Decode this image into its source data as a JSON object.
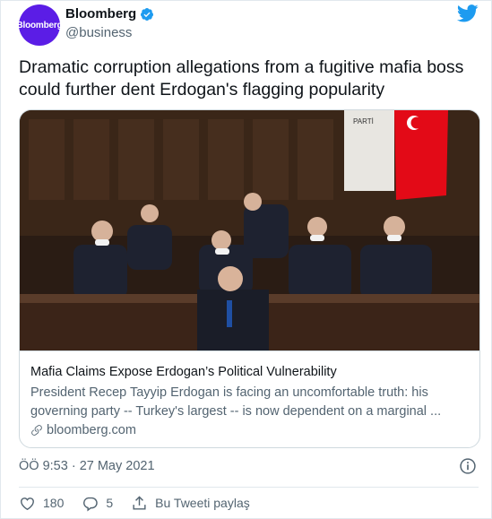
{
  "author": {
    "avatar_text": "Bloomberg",
    "name": "Bloomberg",
    "handle": "@business",
    "avatar_color": "#5b1de6",
    "verified_color": "#1d9bf0"
  },
  "tweet": {
    "text": "Dramatic corruption allegations from a fugitive mafia boss could further dent Erdogan's flagging popularity",
    "timestamp": "ÖÖ 9:53 · 27 May 2021"
  },
  "card": {
    "image_alt": "Photo of politicians seated at a parliament podium with a Turkish flag",
    "image_signage_text": "PARTİ",
    "title": "Mafia Claims Expose Erdogan’s Political Vulnerability",
    "description": "President Recep Tayyip Erdogan is facing an uncomfortable truth: his governing party -- Turkey's largest -- is now dependent on a marginal ...",
    "domain": "bloomberg.com"
  },
  "actions": {
    "likes": "180",
    "replies": "5",
    "share_label": "Bu Tweeti paylaş"
  },
  "icons": {
    "brand": "twitter-bird-icon",
    "verified": "verified-badge-icon",
    "info": "info-icon",
    "like": "heart-icon",
    "reply": "reply-icon",
    "share": "share-icon",
    "link": "link-icon"
  },
  "colors": {
    "twitter_blue": "#1d9bf0",
    "flag_red": "#e30a17"
  }
}
